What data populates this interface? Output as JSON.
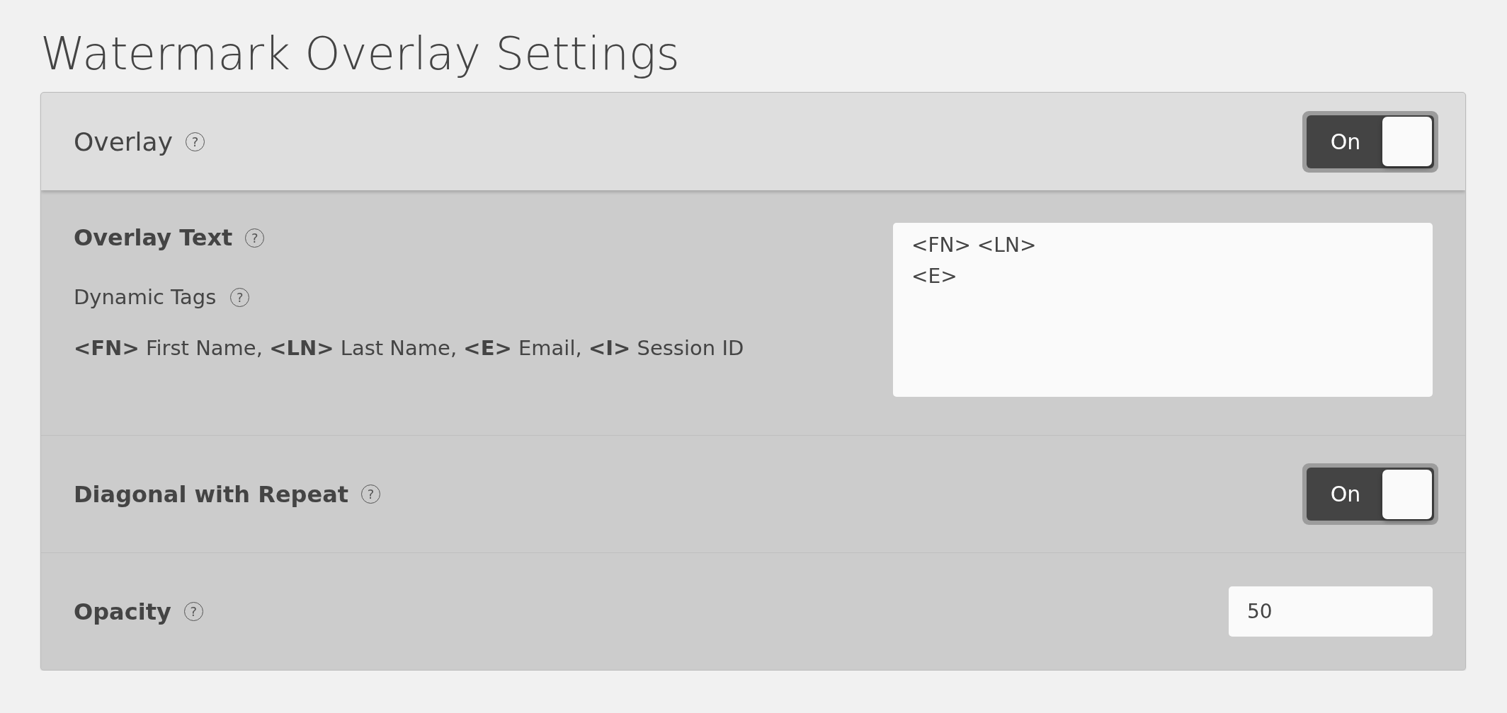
{
  "page_title": "Watermark Overlay Settings",
  "settings": [
    {
      "kind": "header_toggle",
      "label": "Overlay",
      "help": "?",
      "on": true,
      "toggle_label": "On"
    },
    {
      "kind": "text",
      "label": "Overlay Text",
      "help": "?",
      "sublabel": "Dynamic Tags",
      "sublabel_help": "?",
      "legend": "**<FN>** First Name, **<LN>** Last Name, **<E>** Email, **<I>** Session ID",
      "value": "<FN> <LN>\n<E>"
    },
    {
      "kind": "toggle",
      "label": "Diagonal with Repeat",
      "help": "?",
      "on": true,
      "toggle_label": "On"
    },
    {
      "kind": "number",
      "label": "Opacity",
      "help": "?",
      "value": "50"
    }
  ]
}
